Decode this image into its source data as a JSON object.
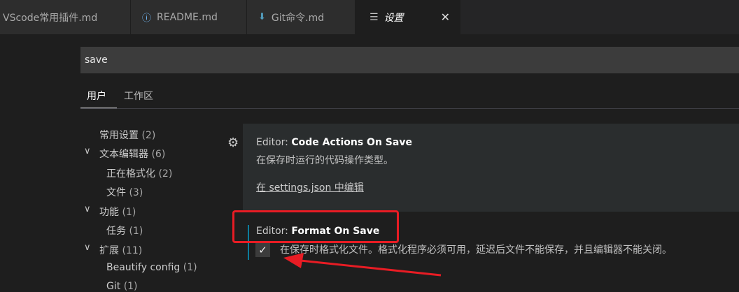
{
  "tabs": [
    {
      "label": "VScode常用插件.md",
      "icon": ""
    },
    {
      "label": "README.md",
      "icon": "info-icon"
    },
    {
      "label": "Git命令.md",
      "icon": "markdown-arrow-icon"
    },
    {
      "label": "设置",
      "icon": "settings-icon",
      "close": "✕"
    }
  ],
  "search": {
    "value": "save"
  },
  "scope": {
    "user": "用户",
    "workspace": "工作区"
  },
  "toc": [
    {
      "label": "常用设置",
      "count": "(2)"
    },
    {
      "label": "文本编辑器",
      "count": "(6)"
    },
    {
      "label": "正在格式化",
      "count": "(2)"
    },
    {
      "label": "文件",
      "count": "(3)"
    },
    {
      "label": "功能",
      "count": "(1)"
    },
    {
      "label": "任务",
      "count": "(1)"
    },
    {
      "label": "扩展",
      "count": "(11)"
    },
    {
      "label": "Beautify config",
      "count": "(1)"
    },
    {
      "label": "Git",
      "count": "(1)"
    }
  ],
  "settings": [
    {
      "category": "Editor: ",
      "name": "Code Actions On Save",
      "description": "在保存时运行的代码操作类型。",
      "link": "在 settings.json 中编辑"
    },
    {
      "category": "Editor: ",
      "name": "Format On Save",
      "description": "在保存时格式化文件。格式化程序必须可用，延迟后文件不能保存，并且编辑器不能关闭。",
      "checked": true
    }
  ],
  "colors": {
    "highlight": "#e81c24",
    "modified": "#0c7d9d"
  }
}
